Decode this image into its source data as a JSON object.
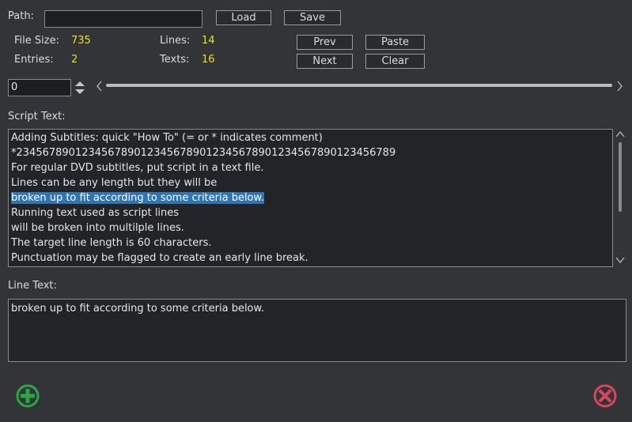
{
  "path": {
    "label": "Path:",
    "value": ""
  },
  "buttons": {
    "load": "Load",
    "save": "Save",
    "prev": "Prev",
    "paste": "Paste",
    "next": "Next",
    "clear": "Clear"
  },
  "stats": {
    "file_size_label": "File Size:",
    "file_size": "735",
    "lines_label": "Lines:",
    "lines": "14",
    "entries_label": "Entries:",
    "entries": "2",
    "texts_label": "Texts:",
    "texts": "16"
  },
  "position": {
    "spin_value": "0",
    "slider_fraction": 0
  },
  "script": {
    "label": "Script Text:",
    "lines": [
      "Adding Subtitles: quick \"How To\" (= or * indicates comment)",
      "*234567890123456789012345678901234567890123456789012345678​9",
      "For regular DVD subtitles, put script in a text file.",
      "Lines can be any length but they will be",
      "broken up to fit according to some criteria below.",
      "Running text used as script lines",
      "will be broken into multilple lines.",
      "The target line length is 60 characters.",
      "Punctuation may be flagged to create an early line break."
    ],
    "selected_line": 4
  },
  "line_text": {
    "label": "Line Text:",
    "value": "broken up to fit according to some criteria below."
  },
  "colors": {
    "accent_add": "#29a845",
    "accent_delete": "#d9455d",
    "selection": "#2f74b3",
    "value_yellow": "#e8e21a"
  }
}
